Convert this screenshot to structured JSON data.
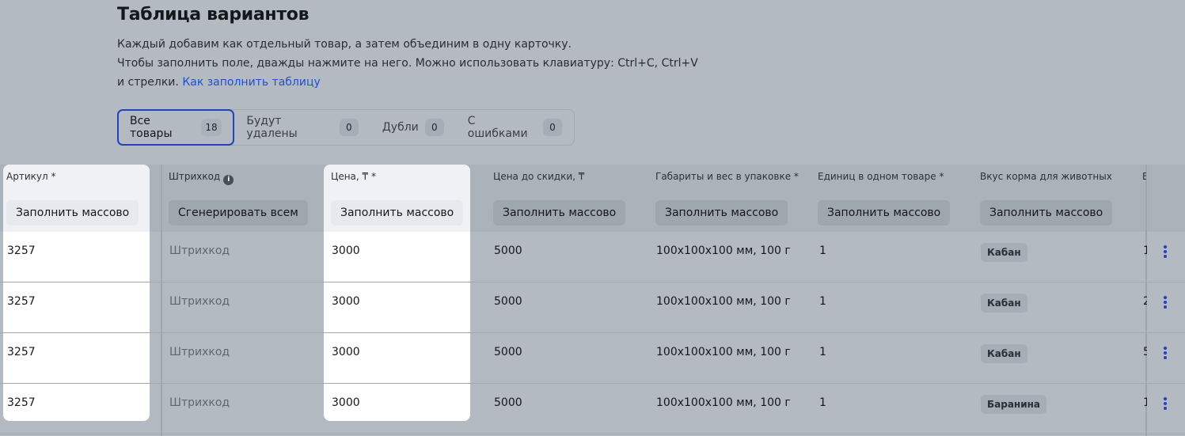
{
  "page": {
    "title": "Таблица вариантов",
    "desc_line1": "Каждый добавим как отдельный товар, а затем объединим в одну карточку.",
    "desc_line2": "Чтобы заполнить поле, дважды нажмите на него. Можно использовать клавиатуру: Ctrl+C, Ctrl+V",
    "desc_line3": "и стрелки.",
    "help_link": "Как заполнить таблицу"
  },
  "tabs": [
    {
      "label": "Все товары",
      "count": "18"
    },
    {
      "label": "Будут удалены",
      "count": "0"
    },
    {
      "label": "Дубли",
      "count": "0"
    },
    {
      "label": "С ошибками",
      "count": "0"
    }
  ],
  "columns": [
    {
      "label": "Артикул *",
      "button": "Заполнить массово"
    },
    {
      "label": "Штрихкод",
      "button": "Сгенерировать всем"
    },
    {
      "label": "Цена, ₸ *",
      "button": "Заполнить массово"
    },
    {
      "label": "Цена до скидки, ₸",
      "button": "Заполнить массово"
    },
    {
      "label": "Габариты и вес в упаковке *",
      "button": "Заполнить массово"
    },
    {
      "label": "Единиц в одном товаре *",
      "button": "Заполнить массово"
    },
    {
      "label": "Вкус корма для животных",
      "button": "Заполнить массово"
    },
    {
      "label": "В"
    }
  ],
  "rows": [
    {
      "sku": "3257",
      "barcode": "Штрихкод",
      "price": "3000",
      "old_price": "5000",
      "dims": "100x100x100 мм, 100 г",
      "units": "1",
      "taste": "Кабан",
      "next": "1"
    },
    {
      "sku": "3257",
      "barcode": "Штрихкод",
      "price": "3000",
      "old_price": "5000",
      "dims": "100x100x100 мм, 100 г",
      "units": "1",
      "taste": "Кабан",
      "next": "2"
    },
    {
      "sku": "3257",
      "barcode": "Штрихкод",
      "price": "3000",
      "old_price": "5000",
      "dims": "100x100x100 мм, 100 г",
      "units": "1",
      "taste": "Кабан",
      "next": "5"
    },
    {
      "sku": "3257",
      "barcode": "Штрихкод",
      "price": "3000",
      "old_price": "5000",
      "dims": "100x100x100 мм, 100 г",
      "units": "1",
      "taste": "Баранина",
      "next": "1"
    }
  ],
  "colors": {
    "accent": "#2145b8",
    "link": "#1f4fd6"
  }
}
